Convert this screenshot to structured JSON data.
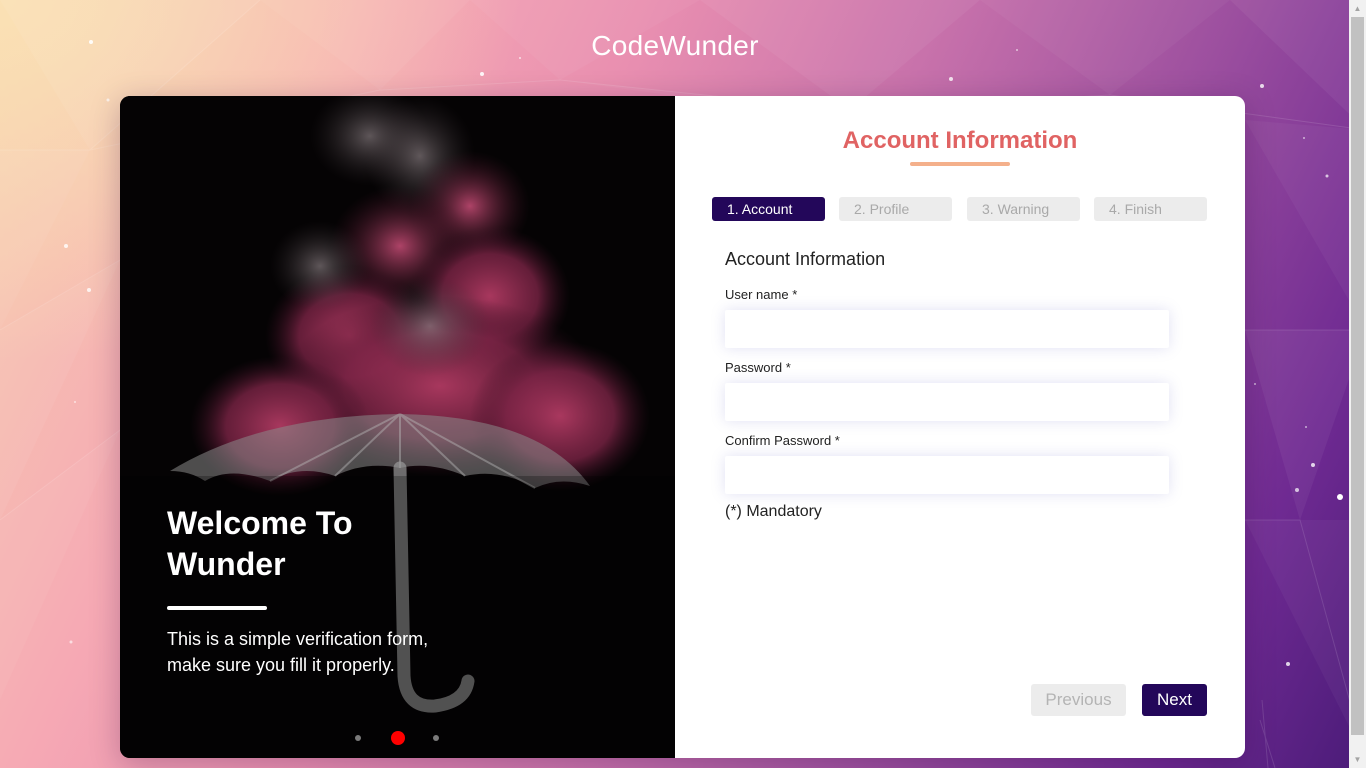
{
  "site": {
    "title": "CodeWunder"
  },
  "hero": {
    "title": "Welcome To Wunder",
    "text": "This is a simple verification form, make sure you fill it properly.",
    "carousel": {
      "slides": 3,
      "active_index": 1,
      "active_color": "#ff0000"
    }
  },
  "form": {
    "heading": "Account Information",
    "steps": [
      {
        "label": "1. Account",
        "active": true
      },
      {
        "label": "2. Profile",
        "active": false
      },
      {
        "label": "3. Warning",
        "active": false
      },
      {
        "label": "4. Finish",
        "active": false
      }
    ],
    "section_title": "Account Information",
    "fields": {
      "username": {
        "label": "User name *",
        "value": ""
      },
      "password": {
        "label": "Password *",
        "value": ""
      },
      "confirm_password": {
        "label": "Confirm Password *",
        "value": ""
      }
    },
    "mandatory_note": "(*) Mandatory",
    "buttons": {
      "previous": "Previous",
      "next": "Next"
    }
  },
  "colors": {
    "primary": "#23075a",
    "heading": "#e06363",
    "heading_underline": "#f4b08b",
    "inactive_step_bg": "#ececec",
    "inactive_step_text": "#a9a9a9"
  },
  "icons": {
    "scroll_up": "scroll-up-arrow-icon",
    "scroll_down": "scroll-down-arrow-icon"
  }
}
